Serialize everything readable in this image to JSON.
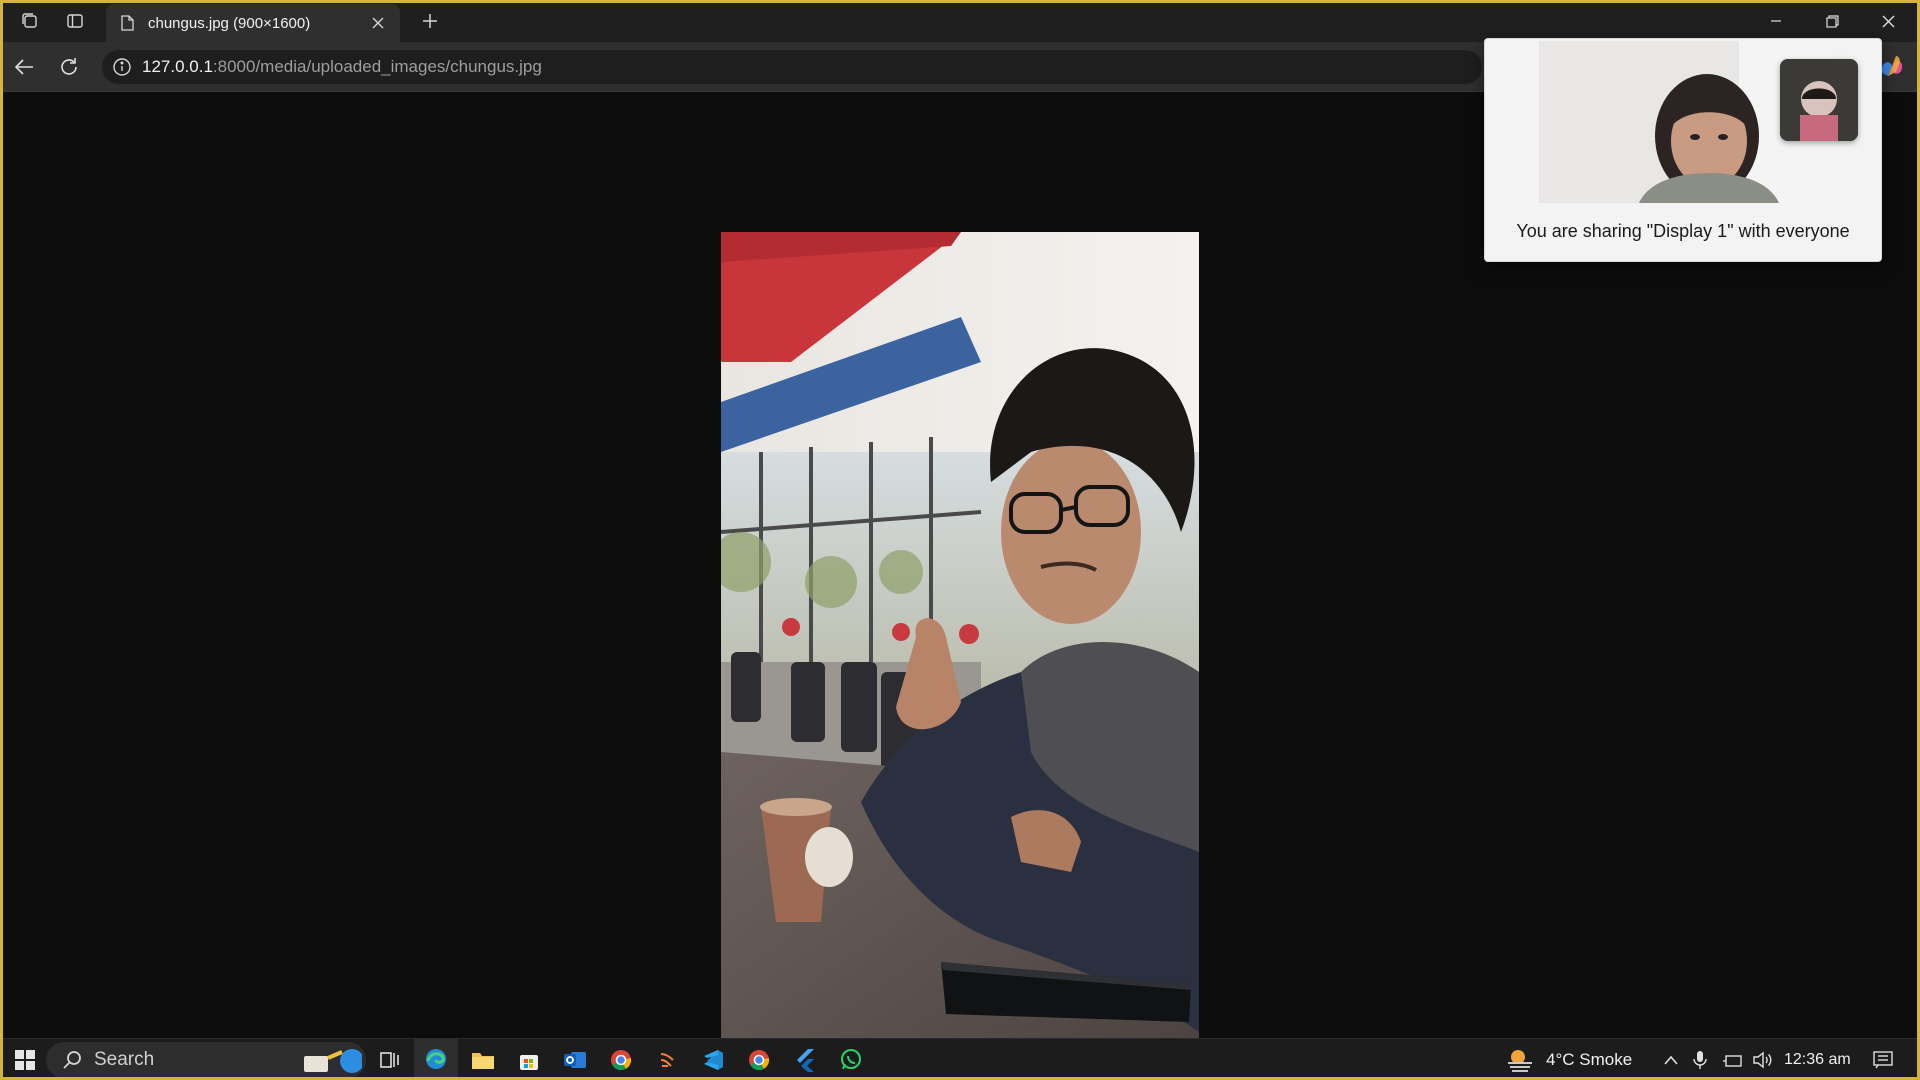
{
  "browser": {
    "tab_title": "chungus.jpg (900×1600)",
    "url_host": "127.0.0.1",
    "url_path": ":8000/media/uploaded_images/chungus.jpg"
  },
  "image": {
    "alt": "chungus.jpg"
  },
  "screen_share": {
    "message": "You are sharing \"Display 1\" with everyone"
  },
  "taskbar": {
    "search_label": "Search",
    "weather": "4°C  Smoke",
    "time": "12:36 am",
    "pinned_apps": [
      "edge-icon",
      "file-explorer-icon",
      "store-icon",
      "outlook-icon",
      "chrome-icon",
      "git-icon",
      "vscode-icon",
      "chrome-icon",
      "flutter-icon",
      "whatsapp-icon"
    ]
  },
  "colors": {
    "frame_border": "#d6b43a",
    "accent": "#6aa9e9"
  }
}
